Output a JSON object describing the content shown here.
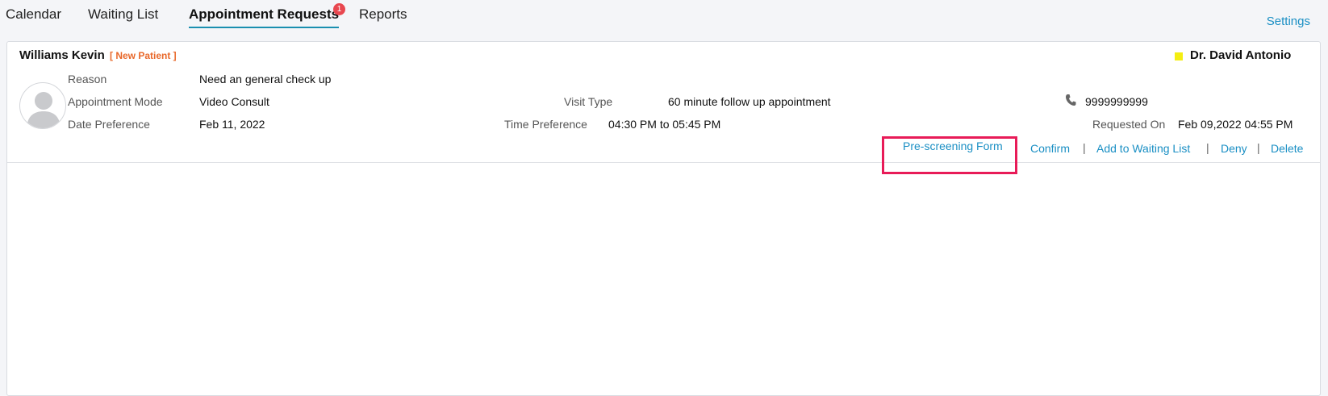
{
  "nav": {
    "tabs": [
      "Calendar",
      "Waiting List",
      "Appointment Requests",
      "Reports"
    ],
    "active_tab": "Appointment Requests",
    "badge_count": "1",
    "settings_label": "Settings"
  },
  "request": {
    "patient_name": "Williams Kevin",
    "patient_tag": "[ New Patient ]",
    "doctor_name": "Dr. David Antonio",
    "doctor_color": "#f4ee12",
    "reason_label": "Reason",
    "reason_value": "Need an general check up",
    "mode_label": "Appointment Mode",
    "mode_value": "Video Consult",
    "visit_type_label": "Visit Type",
    "visit_type_value": "60 minute follow up appointment",
    "phone_icon": "phone-icon",
    "phone_value": "9999999999",
    "date_pref_label": "Date Preference",
    "date_pref_value": "Feb 11, 2022",
    "time_pref_label": "Time Preference",
    "time_pref_value": "04:30 PM to 05:45 PM",
    "requested_on_label": "Requested On",
    "requested_on_value": "Feb 09,2022 04:55 PM"
  },
  "actions": {
    "prescreening": "Pre-screening Form",
    "confirm": "Confirm",
    "waiting_list": "Add to Waiting List",
    "deny": "Deny",
    "delete": "Delete",
    "separator": "|"
  },
  "colors": {
    "accent": "#1a8fc4",
    "badge": "#e8474f",
    "new_patient": "#e8682a",
    "highlight": "#e81b58"
  }
}
